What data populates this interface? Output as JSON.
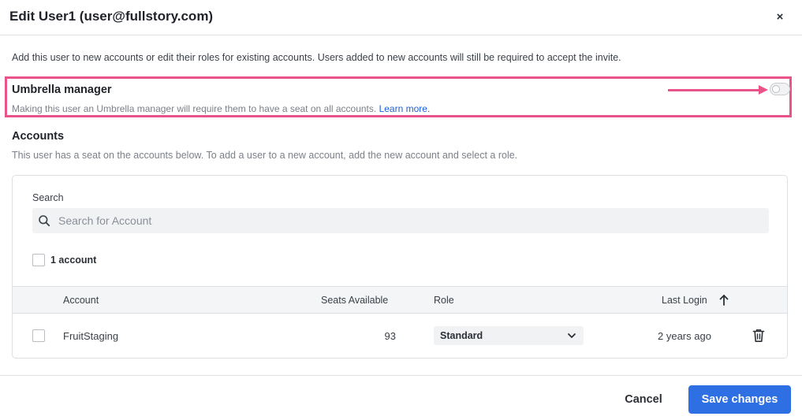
{
  "modal": {
    "title": "Edit User1 (user@fullstory.com)",
    "close_icon": "×"
  },
  "intro": "Add this user to new accounts or edit their roles for existing accounts. Users added to new accounts will still be required to accept the invite.",
  "umbrella": {
    "title": "Umbrella manager",
    "description": "Making this user an Umbrella manager will require them to have a seat on all accounts.",
    "link": "Learn more.",
    "enabled": false,
    "highlight_color": "#e9538a"
  },
  "accounts": {
    "title": "Accounts",
    "description": "This user has a seat on the accounts below. To add a user to a new account, add the new account and select a role.",
    "search_label": "Search",
    "search_placeholder": "Search for Account",
    "search_value": "",
    "select_all_label": "1 account",
    "columns": {
      "account": "Account",
      "seats": "Seats Available",
      "role": "Role",
      "last_login": "Last Login"
    },
    "sort": "last-login-ascending",
    "rows": [
      {
        "account": "FruitStaging",
        "seats": "93",
        "role": "Standard",
        "last_login": "2 years ago"
      }
    ]
  },
  "footer": {
    "cancel_label": "Cancel",
    "save_label": "Save changes"
  },
  "colors": {
    "accent": "#2f6fe4",
    "link": "#1d5fd6",
    "highlight": "#e9538a"
  },
  "icons": {
    "close": "close-icon",
    "toggle": "toggle-switch",
    "search": "search-icon",
    "sort": "arrow-up-icon",
    "dropdown": "chevron-down-icon",
    "delete": "trash-icon"
  }
}
